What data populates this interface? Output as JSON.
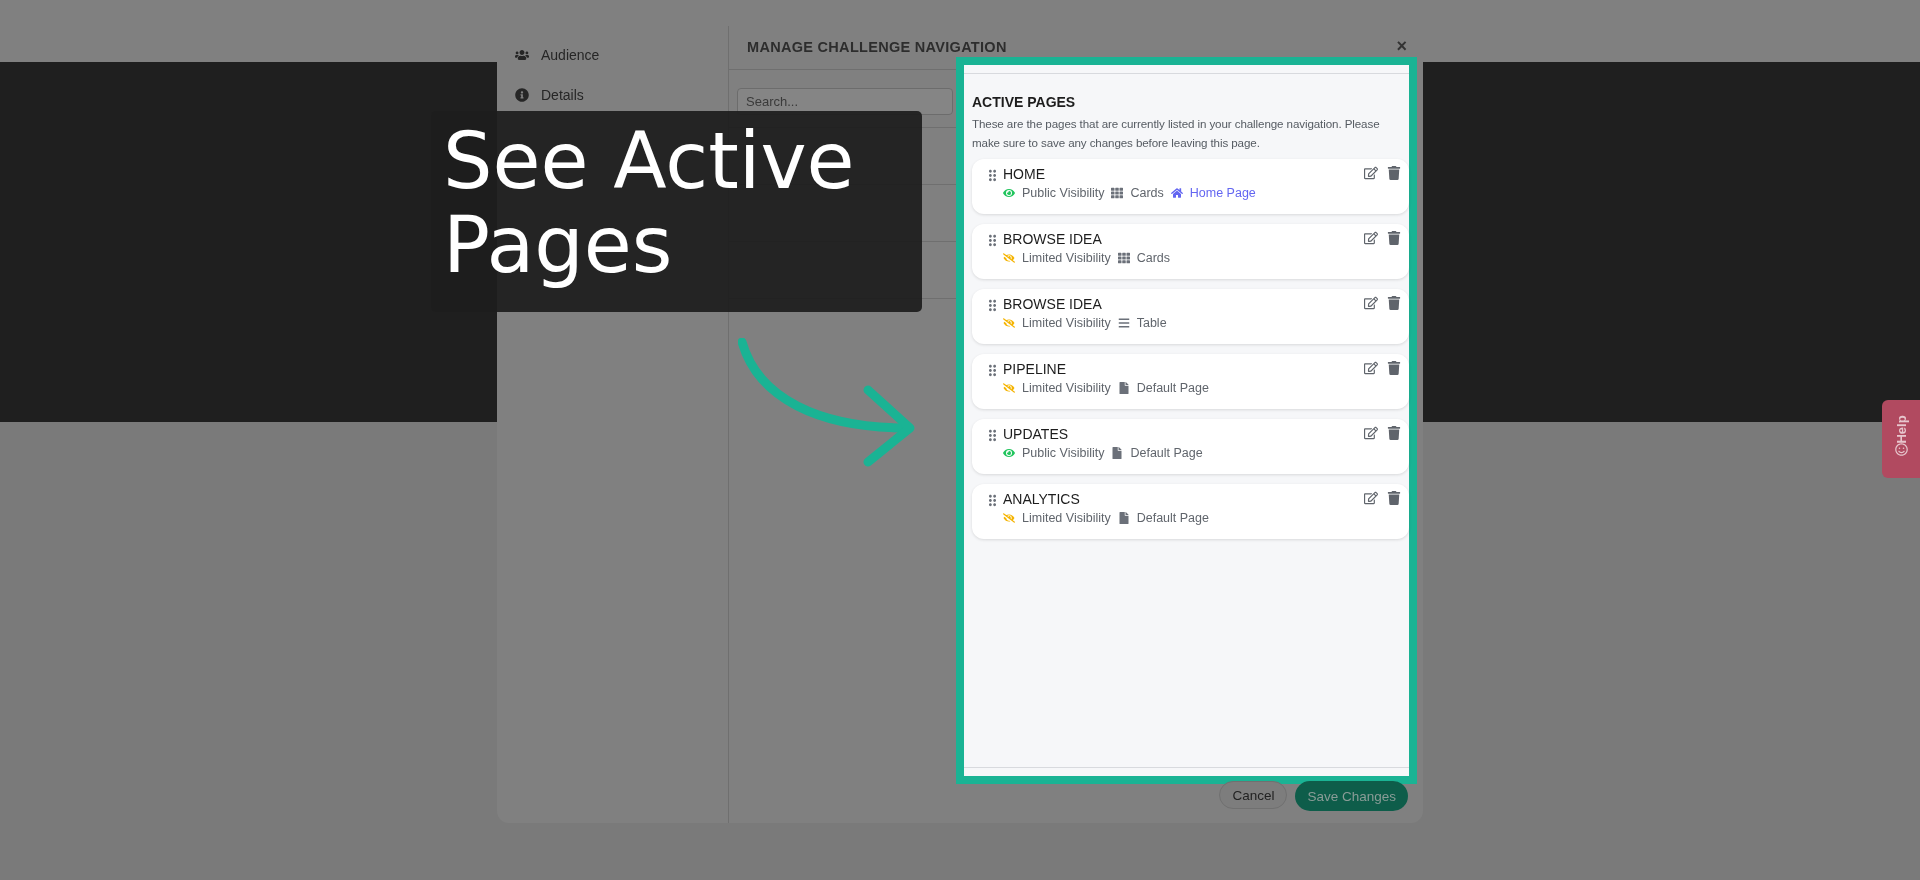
{
  "callout": {
    "text": "See Active Pages"
  },
  "modal": {
    "title": "MANAGE CHALLENGE NAVIGATION",
    "close": "×",
    "sidebar": [
      {
        "label": "Audience",
        "kind": "audience",
        "selected": false
      },
      {
        "label": "Details",
        "kind": "details",
        "selected": false
      }
    ],
    "search": {
      "placeholder": "Search..."
    },
    "active_pages": {
      "heading": "ACTIVE PAGES",
      "description": "These are the pages that are currently listed in your challenge navigation. Please make sure to save any changes before leaving this page.",
      "pages": [
        {
          "name": "HOME",
          "visibility": {
            "kind": "public",
            "label": "Public Visibility"
          },
          "layout": {
            "kind": "cards",
            "label": "Cards"
          },
          "home": "Home Page"
        },
        {
          "name": "BROWSE IDEA",
          "visibility": {
            "kind": "limited",
            "label": "Limited Visibility"
          },
          "layout": {
            "kind": "cards",
            "label": "Cards"
          }
        },
        {
          "name": "BROWSE IDEA",
          "visibility": {
            "kind": "limited",
            "label": "Limited Visibility"
          },
          "layout": {
            "kind": "table",
            "label": "Table"
          }
        },
        {
          "name": "PIPELINE",
          "visibility": {
            "kind": "limited",
            "label": "Limited Visibility"
          },
          "layout": {
            "kind": "default",
            "label": "Default Page"
          }
        },
        {
          "name": "UPDATES",
          "visibility": {
            "kind": "public",
            "label": "Public Visibility"
          },
          "layout": {
            "kind": "default",
            "label": "Default Page"
          }
        },
        {
          "name": "ANALYTICS",
          "visibility": {
            "kind": "limited",
            "label": "Limited Visibility"
          },
          "layout": {
            "kind": "default",
            "label": "Default Page"
          }
        }
      ]
    },
    "buttons": {
      "cancel": "Cancel",
      "save": "Save Changes"
    }
  },
  "help_tab": {
    "label": "Help"
  }
}
